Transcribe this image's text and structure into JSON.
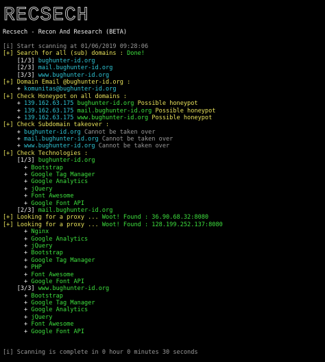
{
  "header": {
    "logo": "RECSECH",
    "subtitle": "Recsech - Recon And Research (BETA)"
  },
  "colors": {
    "background": "#000000",
    "info_yellow": "#e6e05a",
    "success_green": "#3ee03e",
    "ip_cyan": "#2fc4d4",
    "text_white": "#eeeeee",
    "muted_gray": "#9a9a9a"
  },
  "lines": [
    [
      {
        "t": "[i] Start scanning at 01/06/2019 09:28:06",
        "c": "gr"
      }
    ],
    [
      {
        "t": "[+] Search for all (sub) domains : ",
        "c": "y"
      },
      {
        "t": "Done!",
        "c": "g"
      }
    ],
    [
      {
        "t": "    [1/3] ",
        "c": "w"
      },
      {
        "t": "bughunter-id.org",
        "c": "c"
      }
    ],
    [
      {
        "t": "    [2/3] ",
        "c": "w"
      },
      {
        "t": "mail.bughunter-id.org",
        "c": "c"
      }
    ],
    [
      {
        "t": "    [3/3] ",
        "c": "w"
      },
      {
        "t": "www.bughunter-id.org",
        "c": "c"
      }
    ],
    [
      {
        "t": "[+] Domain Email @bughunter-id.org :",
        "c": "y"
      }
    ],
    [
      {
        "t": "    + ",
        "c": "w"
      },
      {
        "t": "komunitas@bughunter-id.org",
        "c": "c"
      }
    ],
    [
      {
        "t": "[+] Check Honeypot on all domains :",
        "c": "y"
      }
    ],
    [
      {
        "t": "    + ",
        "c": "w"
      },
      {
        "t": "139.162.63.175",
        "c": "c"
      },
      {
        "t": " bughunter-id.org ",
        "c": "g"
      },
      {
        "t": "Possible honeypot",
        "c": "y"
      }
    ],
    [
      {
        "t": "    + ",
        "c": "w"
      },
      {
        "t": "139.162.63.175",
        "c": "c"
      },
      {
        "t": " mail.bughunter-id.org ",
        "c": "g"
      },
      {
        "t": "Possible honeypot",
        "c": "y"
      }
    ],
    [
      {
        "t": "    + ",
        "c": "w"
      },
      {
        "t": "139.162.63.175",
        "c": "c"
      },
      {
        "t": " www.bughunter-id.org ",
        "c": "g"
      },
      {
        "t": "Possible honeypot",
        "c": "y"
      }
    ],
    [
      {
        "t": "[+] Check Subdomain takeover :",
        "c": "y"
      }
    ],
    [
      {
        "t": "    + ",
        "c": "w"
      },
      {
        "t": "bughunter-id.org",
        "c": "c"
      },
      {
        "t": " Cannot be taken over",
        "c": "gr"
      }
    ],
    [
      {
        "t": "    + ",
        "c": "w"
      },
      {
        "t": "mail.bughunter-id.org",
        "c": "c"
      },
      {
        "t": " Cannot be taken over",
        "c": "gr"
      }
    ],
    [
      {
        "t": "    + ",
        "c": "w"
      },
      {
        "t": "www.bughunter-id.org",
        "c": "c"
      },
      {
        "t": " Cannot be taken over",
        "c": "gr"
      }
    ],
    [
      {
        "t": "[+] Check Technologies :",
        "c": "y"
      }
    ],
    [
      {
        "t": "    [1/3] ",
        "c": "w"
      },
      {
        "t": "bughunter-id.org",
        "c": "g"
      }
    ],
    [
      {
        "t": "      + ",
        "c": "w"
      },
      {
        "t": "Bootstrap",
        "c": "g"
      }
    ],
    [
      {
        "t": "      + ",
        "c": "w"
      },
      {
        "t": "Google Tag Manager",
        "c": "g"
      }
    ],
    [
      {
        "t": "      + ",
        "c": "w"
      },
      {
        "t": "Google Analytics",
        "c": "g"
      }
    ],
    [
      {
        "t": "      + ",
        "c": "w"
      },
      {
        "t": "jQuery",
        "c": "g"
      }
    ],
    [
      {
        "t": "      + ",
        "c": "w"
      },
      {
        "t": "Font Awesome",
        "c": "g"
      }
    ],
    [
      {
        "t": "      + ",
        "c": "w"
      },
      {
        "t": "Google Font API",
        "c": "g"
      }
    ],
    [
      {
        "t": "    [2/3] ",
        "c": "w"
      },
      {
        "t": "mail.bughunter-id.org",
        "c": "g"
      }
    ],
    [
      {
        "t": "[+] Looking for a proxy ... ",
        "c": "y"
      },
      {
        "t": "Woot! Found : 36.90.68.32:8080",
        "c": "g"
      }
    ],
    [
      {
        "t": "[+] Looking for a proxy ... ",
        "c": "y"
      },
      {
        "t": "Woot! Found : 128.199.252.137:8080",
        "c": "g"
      }
    ],
    [
      {
        "t": "      + ",
        "c": "w"
      },
      {
        "t": "Nginx",
        "c": "g"
      }
    ],
    [
      {
        "t": "      + ",
        "c": "w"
      },
      {
        "t": "Google Analytics",
        "c": "g"
      }
    ],
    [
      {
        "t": "      + ",
        "c": "w"
      },
      {
        "t": "jQuery",
        "c": "g"
      }
    ],
    [
      {
        "t": "      + ",
        "c": "w"
      },
      {
        "t": "Bootstrap",
        "c": "g"
      }
    ],
    [
      {
        "t": "      + ",
        "c": "w"
      },
      {
        "t": "Google Tag Manager",
        "c": "g"
      }
    ],
    [
      {
        "t": "      + ",
        "c": "w"
      },
      {
        "t": "PHP",
        "c": "g"
      }
    ],
    [
      {
        "t": "      + ",
        "c": "w"
      },
      {
        "t": "Font Awesome",
        "c": "g"
      }
    ],
    [
      {
        "t": "      + ",
        "c": "w"
      },
      {
        "t": "Google Font API",
        "c": "g"
      }
    ],
    [
      {
        "t": "    [3/3] ",
        "c": "w"
      },
      {
        "t": "www.bughunter-id.org",
        "c": "g"
      }
    ],
    [
      {
        "t": "      + ",
        "c": "w"
      },
      {
        "t": "Bootstrap",
        "c": "g"
      }
    ],
    [
      {
        "t": "      + ",
        "c": "w"
      },
      {
        "t": "Google Tag Manager",
        "c": "g"
      }
    ],
    [
      {
        "t": "      + ",
        "c": "w"
      },
      {
        "t": "Google Analytics",
        "c": "g"
      }
    ],
    [
      {
        "t": "      + ",
        "c": "w"
      },
      {
        "t": "jQuery",
        "c": "g"
      }
    ],
    [
      {
        "t": "      + ",
        "c": "w"
      },
      {
        "t": "Font Awesome",
        "c": "g"
      }
    ],
    [
      {
        "t": "      + ",
        "c": "w"
      },
      {
        "t": "Google Font API",
        "c": "g"
      }
    ]
  ],
  "footer": {
    "status": "[i] Scanning is complete in 0 hour 0 minutes 30 seconds"
  }
}
